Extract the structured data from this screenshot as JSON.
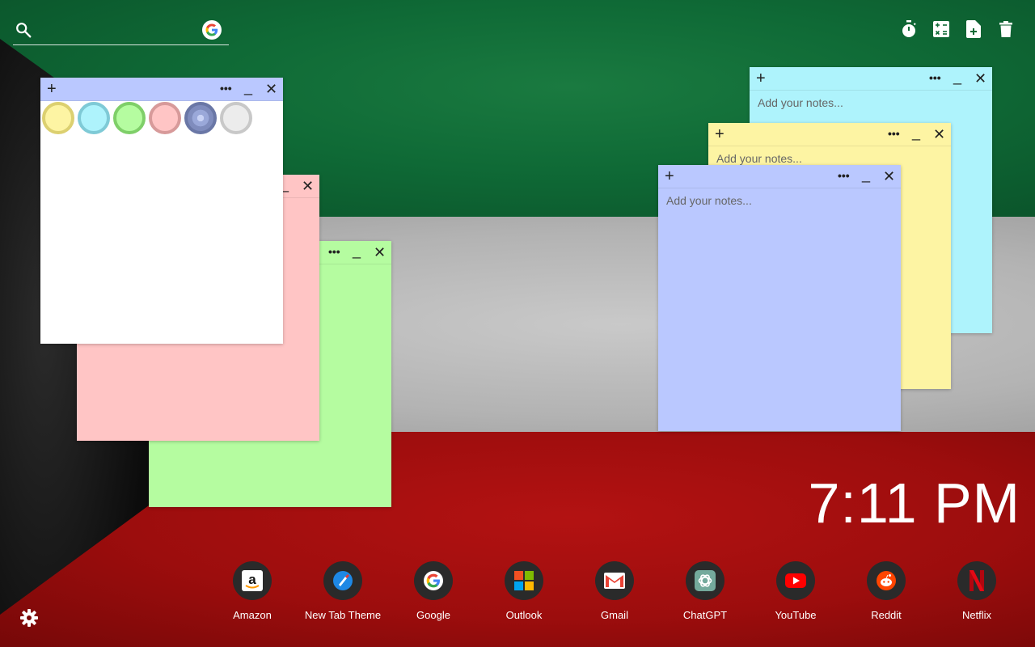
{
  "search": {
    "placeholder": ""
  },
  "tools": [
    {
      "name": "timer-icon"
    },
    {
      "name": "calculator-icon"
    },
    {
      "name": "new-note-icon"
    },
    {
      "name": "delete-icon"
    }
  ],
  "notes": {
    "add_label": "+",
    "more_label": "•••",
    "min_label": "_",
    "close_label": "✕",
    "placeholder": "Add your notes...",
    "colors": {
      "white": "#ffffff",
      "pink": "#ffc5c5",
      "green": "#b5fca0",
      "cyan": "#aef3fc",
      "yellow": "#fdf4a3",
      "blue": "#bac8ff",
      "header_blue": "#bac8ff"
    }
  },
  "color_swatches": [
    {
      "name": "yellow",
      "fill": "#fdf4a3",
      "ring": "#dcd070"
    },
    {
      "name": "cyan",
      "fill": "#aef3fc",
      "ring": "#7fcad6"
    },
    {
      "name": "green",
      "fill": "#b5fca0",
      "ring": "#7fcf69"
    },
    {
      "name": "pink",
      "fill": "#ffc5c5",
      "ring": "#d79a9a"
    },
    {
      "name": "blue",
      "fill": "#8e9ccd",
      "ring": "#6a77a6",
      "selected": true
    },
    {
      "name": "gray",
      "fill": "#ececec",
      "ring": "#c8c8c8"
    }
  ],
  "clock": {
    "time": "7:11 PM"
  },
  "shortcuts": [
    {
      "label": "Amazon",
      "icon": "amazon-icon"
    },
    {
      "label": "New Tab Theme",
      "icon": "new-tab-theme-icon"
    },
    {
      "label": "Google",
      "icon": "google-icon"
    },
    {
      "label": "Outlook",
      "icon": "outlook-icon"
    },
    {
      "label": "Gmail",
      "icon": "gmail-icon"
    },
    {
      "label": "ChatGPT",
      "icon": "chatgpt-icon"
    },
    {
      "label": "YouTube",
      "icon": "youtube-icon"
    },
    {
      "label": "Reddit",
      "icon": "reddit-icon"
    },
    {
      "label": "Netflix",
      "icon": "netflix-icon"
    }
  ]
}
